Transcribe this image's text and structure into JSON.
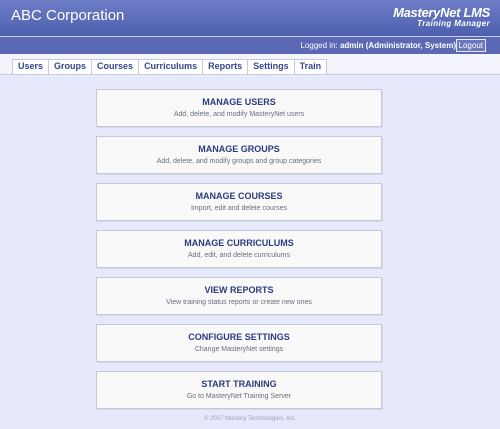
{
  "header": {
    "title": "ABC Corporation",
    "logo_main": "MasteryNet LMS",
    "logo_sub": "Training Manager"
  },
  "userbar": {
    "prefix": "Logged in: ",
    "user": "admin (Administrator, System)",
    "logout_label": "Logout"
  },
  "tabs": [
    {
      "label": "Users"
    },
    {
      "label": "Groups"
    },
    {
      "label": "Courses"
    },
    {
      "label": "Curriculums"
    },
    {
      "label": "Reports"
    },
    {
      "label": "Settings"
    },
    {
      "label": "Train"
    }
  ],
  "menu": [
    {
      "title": "MANAGE USERS",
      "desc": "Add, delete, and modify MasteryNet users"
    },
    {
      "title": "MANAGE GROUPS",
      "desc": "Add, delete, and modify groups and group categories"
    },
    {
      "title": "MANAGE COURSES",
      "desc": "Import, edit and delete courses"
    },
    {
      "title": "MANAGE CURRICULUMS",
      "desc": "Add, edit, and delete curriculums"
    },
    {
      "title": "VIEW REPORTS",
      "desc": "View training status reports or create new ones"
    },
    {
      "title": "CONFIGURE SETTINGS",
      "desc": "Change MasteryNet settings"
    },
    {
      "title": "START TRAINING",
      "desc": "Go to MasteryNet Training Server"
    }
  ],
  "footer": {
    "copyright": "© 2007 Mastery Technologies, Inc."
  },
  "colors": {
    "header": "#5c6cbb",
    "background": "#e6e9fb",
    "title_text": "#2c3b7d"
  }
}
